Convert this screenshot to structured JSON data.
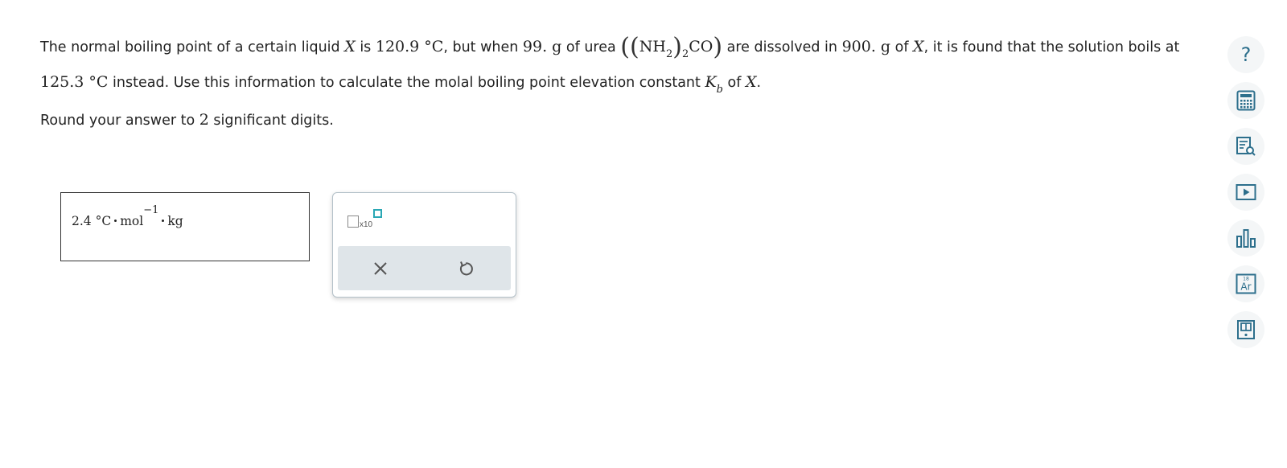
{
  "question": {
    "l1_a": "The normal boiling point of a certain liquid ",
    "var_x": "X",
    "l1_b": " is ",
    "bp_normal": "120.9 °C",
    "l1_c": ", but when ",
    "mass_solute": "99. g",
    "l1_d": " of urea ",
    "paren_open": "(",
    "paren_open2": "(",
    "nh": "NH",
    "sub_2a": "2",
    "paren_close_inner": ")",
    "sub_2b": "2",
    "co": "CO",
    "paren_close": ")",
    "l1_e": " are dissolved in ",
    "mass_solvent": "900. g",
    "l1_f": " of ",
    "var_x2": "X",
    "l1_g": ", it is found that the solution boils at",
    "bp_solution": "125.3 °C",
    "l2_a": " instead. Use this information to calculate the molal boiling point elevation constant ",
    "k": "K",
    "k_sub": "b",
    "l2_b": " of ",
    "var_x3": "X",
    "l2_c": "."
  },
  "instruction": {
    "a": "Round your answer to ",
    "num": "2",
    "b": " significant digits."
  },
  "answer": {
    "value": "2.4",
    "unit_c": "°C",
    "unit_mol": "mol",
    "exponent": "−1",
    "unit_kg": "kg"
  },
  "tools": {
    "x10_label": "x10"
  },
  "colors": {
    "accent": "#2aa7b4",
    "sidebar_icon": "#2d6f8c",
    "action_bar": "#dfe5e9"
  },
  "sidebar": {
    "help_label": "?",
    "periodic_label": "Ar",
    "periodic_number": "18"
  }
}
